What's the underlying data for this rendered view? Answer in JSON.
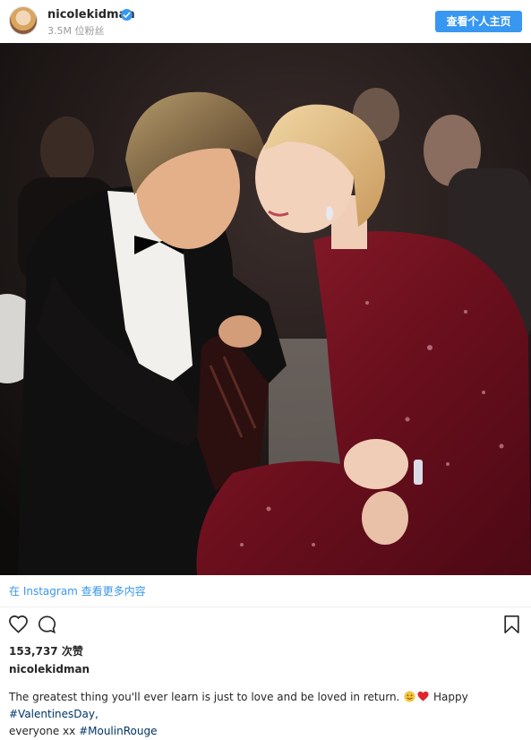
{
  "header": {
    "username": "nicolekidman",
    "followers": "3.5M 位粉丝",
    "profile_button": "查看个人主页"
  },
  "photo": {
    "description_icon": "photo"
  },
  "post": {
    "view_more": "在 Instagram 查看更多内容",
    "likes": "153,737 次赞",
    "caption_username": "nicolekidman",
    "caption_text": "The greatest thing you'll ever learn is just to love and be loved in return.",
    "caption_happy": "Happy",
    "hashtag_1": "#ValentinesDay,",
    "caption_everyone": "everyone xx",
    "hashtag_2": "#MoulinRouge"
  },
  "icons": {
    "like": "heart-outline-icon",
    "comment": "comment-bubble-icon",
    "save": "bookmark-icon",
    "verified": "verified-badge-icon",
    "emoji_smile": "smiling-face-emoji",
    "emoji_heart": "red-heart-emoji"
  },
  "colors": {
    "accent": "#3897f0",
    "hashtag": "#003569",
    "dress": "#7a1424"
  }
}
